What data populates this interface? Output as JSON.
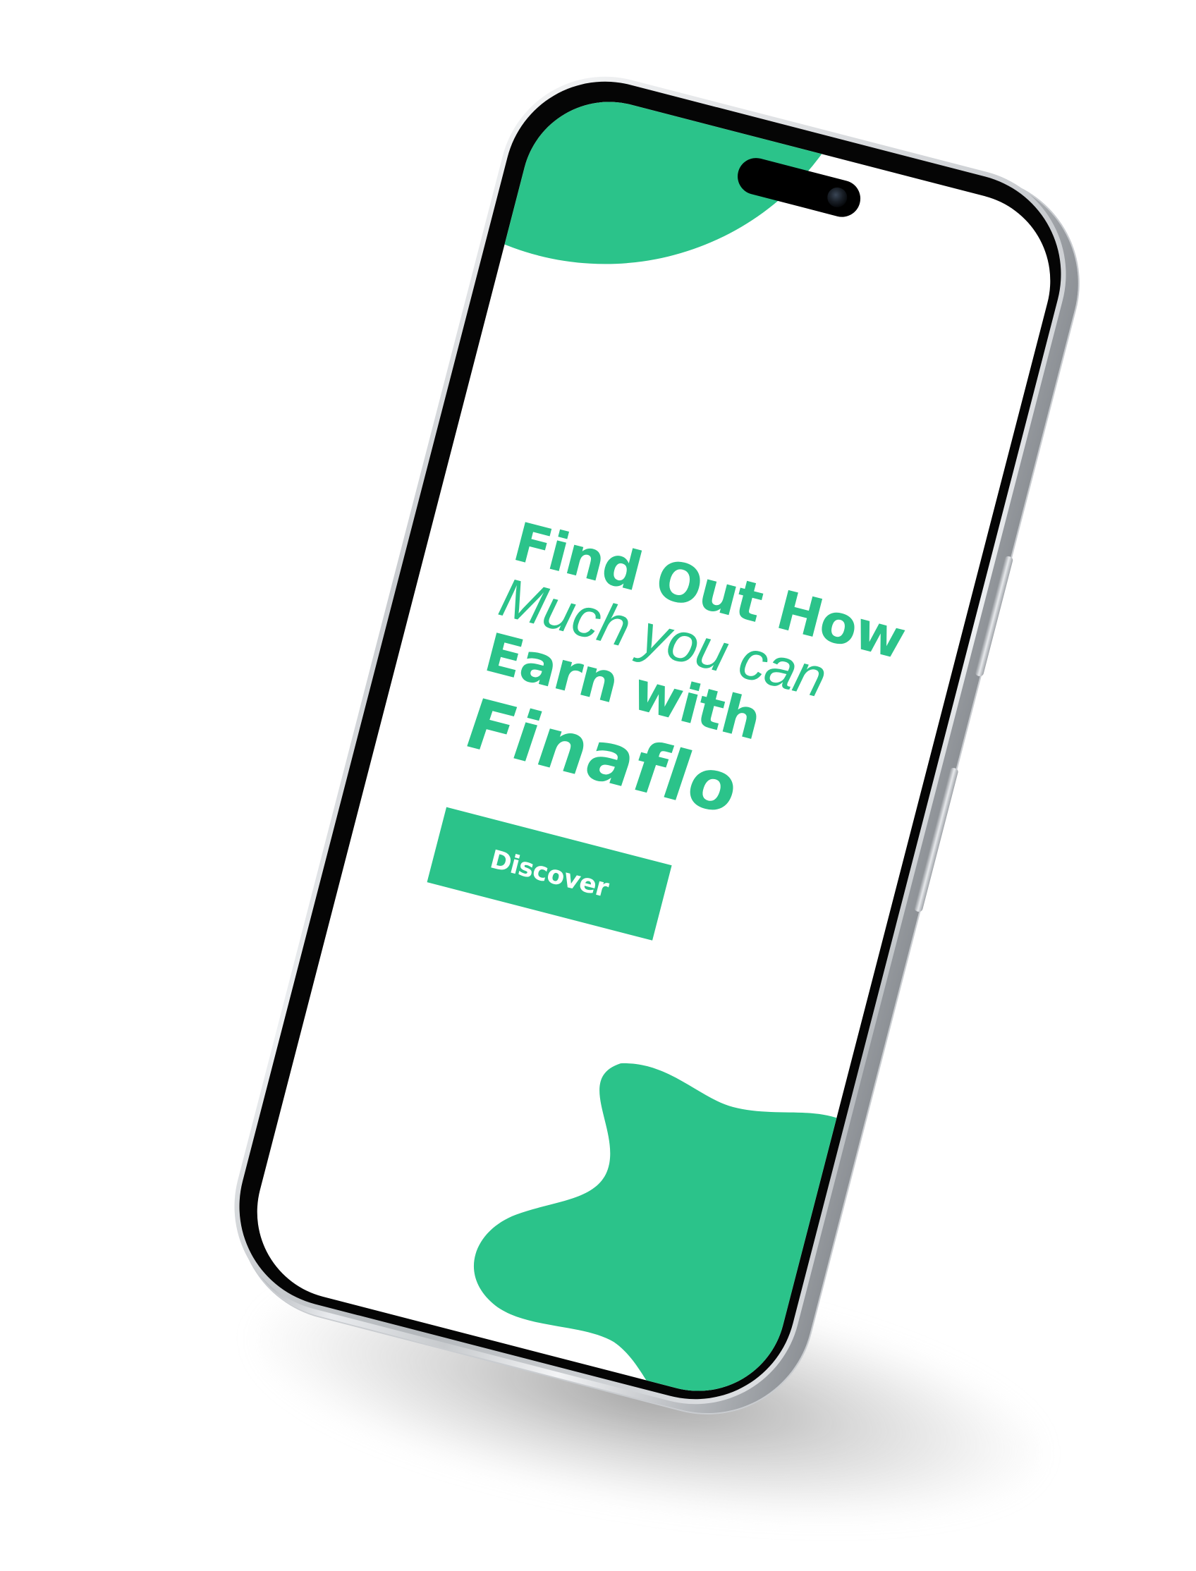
{
  "colors": {
    "brand_green": "#2bc38a",
    "screen_background": "#ffffff",
    "button_text": "#ffffff"
  },
  "hero": {
    "line1": "Find Out How",
    "line2": "Much you can",
    "line3": "Earn with",
    "brand": "Finaflo"
  },
  "cta": {
    "label": "Discover"
  }
}
